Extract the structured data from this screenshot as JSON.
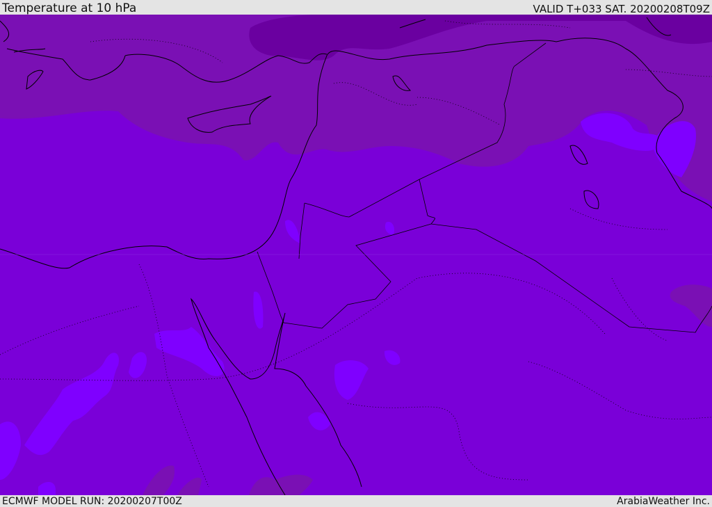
{
  "header": {
    "title": "Temperature at 10 hPa",
    "valid": "VALID T+033 SAT. 20200208T09Z"
  },
  "footer": {
    "model_run": "ECMWF MODEL RUN: 20200207T00Z",
    "credit": "ArabiaWeather Inc."
  },
  "colors": {
    "base": "#7a00d8",
    "cooler": "#7a10b4",
    "coolest": "#6a00a0",
    "warmer": "#7f00ff",
    "border": "#000000"
  }
}
